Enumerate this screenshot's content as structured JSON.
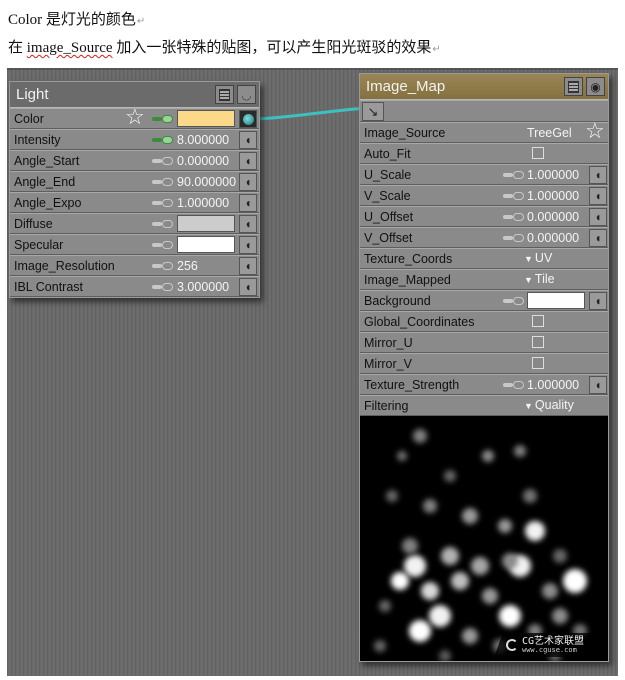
{
  "document": {
    "line1": "Color 是灯光的颜色",
    "line2_prefix": "在 ",
    "line2_term": "image_Source",
    "line2_suffix": " 加入一张特殊的贴图，可以产生阳光斑驳的效果",
    "para_mark": "↵"
  },
  "light_node": {
    "title": "Light",
    "title_buttons": [
      "menu-icon",
      "eye-icon"
    ],
    "rows": [
      {
        "label": "Color",
        "type": "color",
        "link": "green",
        "color": "#fcd889",
        "starred": true,
        "plug": "connected"
      },
      {
        "label": "Intensity",
        "type": "number",
        "link": "green",
        "value": "8.000000"
      },
      {
        "label": "Angle_Start",
        "type": "number",
        "link": "grey",
        "value": "0.000000"
      },
      {
        "label": "Angle_End",
        "type": "number",
        "link": "grey",
        "value": "90.000000"
      },
      {
        "label": "Angle_Expo",
        "type": "number",
        "link": "grey",
        "value": "1.000000"
      },
      {
        "label": "Diffuse",
        "type": "color",
        "link": "grey",
        "color": "#cccccc"
      },
      {
        "label": "Specular",
        "type": "color",
        "link": "grey",
        "color": "#ffffff"
      },
      {
        "label": "Image_Resolution",
        "type": "number",
        "link": "grey",
        "value": "256"
      },
      {
        "label": "IBL Contrast",
        "type": "number",
        "link": "grey",
        "value": "3.000000"
      }
    ]
  },
  "image_map_node": {
    "title": "Image_Map",
    "title_buttons": [
      "menu-icon",
      "eye-icon"
    ],
    "output_plug": "output-plug-icon",
    "rows": [
      {
        "label": "Image_Source",
        "type": "text",
        "value": "TreeGel",
        "starred": true
      },
      {
        "label": "Auto_Fit",
        "type": "checkbox",
        "checked": false
      },
      {
        "label": "U_Scale",
        "type": "number",
        "link": "grey",
        "value": "1.000000"
      },
      {
        "label": "V_Scale",
        "type": "number",
        "link": "grey",
        "value": "1.000000"
      },
      {
        "label": "U_Offset",
        "type": "number",
        "link": "grey",
        "value": "0.000000"
      },
      {
        "label": "V_Offset",
        "type": "number",
        "link": "grey",
        "value": "0.000000"
      },
      {
        "label": "Texture_Coords",
        "type": "dropdown",
        "value": "UV"
      },
      {
        "label": "Image_Mapped",
        "type": "dropdown",
        "value": "Tile"
      },
      {
        "label": "Background",
        "type": "color",
        "link": "grey",
        "color": "#ffffff"
      },
      {
        "label": "Global_Coordinates",
        "type": "checkbox",
        "checked": false
      },
      {
        "label": "Mirror_U",
        "type": "checkbox",
        "checked": false
      },
      {
        "label": "Mirror_V",
        "type": "checkbox",
        "checked": false
      },
      {
        "label": "Texture_Strength",
        "type": "number",
        "link": "grey",
        "value": "1.000000"
      },
      {
        "label": "Filtering",
        "type": "dropdown",
        "value": "Quality"
      }
    ],
    "preview": "TreeGel gobo texture preview"
  },
  "connection": {
    "from": "Light.Color",
    "to": "Image_Map.output",
    "color": "#3fc0c0"
  },
  "watermark": {
    "title": "CG艺术家联盟",
    "url": "www.cguse.com"
  }
}
